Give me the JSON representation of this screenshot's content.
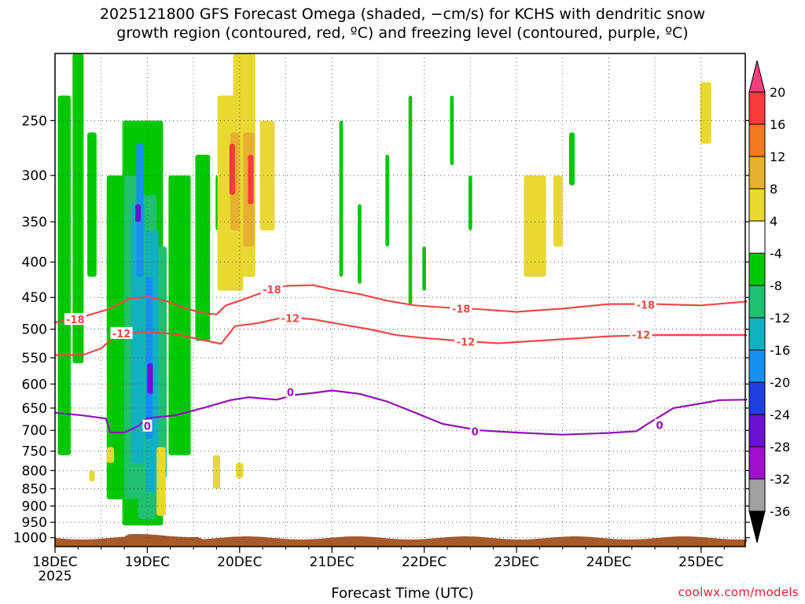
{
  "title": {
    "line1": "2025121800 GFS Forecast Omega (shaded, −cm/s) for KCHS with dendritic snow",
    "line2": "growth region (contoured, red, ºC) and freezing level (contoured, purple, ºC)"
  },
  "xlabel": "Forecast Time (UTC)",
  "credit": "coolwx.com/models",
  "chart_data": {
    "type": "heatmap",
    "title": "2025121800 GFS Forecast Omega (shaded, −cm/s) for KCHS with dendritic snow growth region (contoured, red, ºC) and freezing level (contoured, purple, ºC)",
    "xlabel": "Forecast Time (UTC)",
    "ylabel": "",
    "y_scale": "log-pressure (inverted)",
    "grid": true,
    "x_ticks": [
      {
        "label": "18DEC",
        "sub": "2025",
        "day": 0
      },
      {
        "label": "19DEC",
        "day": 1
      },
      {
        "label": "20DEC",
        "day": 2
      },
      {
        "label": "21DEC",
        "day": 3
      },
      {
        "label": "22DEC",
        "day": 4
      },
      {
        "label": "23DEC",
        "day": 5
      },
      {
        "label": "24DEC",
        "day": 6
      },
      {
        "label": "25DEC",
        "day": 7
      }
    ],
    "xlim_days": [
      0,
      7.5
    ],
    "y_ticks": [
      250,
      300,
      350,
      400,
      450,
      500,
      550,
      600,
      650,
      700,
      750,
      800,
      850,
      900,
      950,
      1000
    ],
    "ylim_hpa": [
      200,
      1030
    ],
    "colorbar": {
      "labels": [
        "20",
        "16",
        "12",
        "8",
        "4",
        "-4",
        "-8",
        "-12",
        "-16",
        "-20",
        "-24",
        "-28",
        "-32",
        "-36"
      ],
      "colors": [
        "#f0407a",
        "#f43c3c",
        "#f07a20",
        "#e8b030",
        "#e8d830",
        "#ffffff",
        "#00c800",
        "#20c070",
        "#10b0c0",
        "#1890f0",
        "#2040e0",
        "#6a10d0",
        "#a010c8",
        "#a0a0a0",
        "#000000"
      ]
    },
    "series": [
      {
        "name": "-18",
        "color": "#f04848",
        "points": [
          [
            0,
            489
          ],
          [
            0.3,
            480
          ],
          [
            0.6,
            467
          ],
          [
            0.8,
            452
          ],
          [
            1.0,
            449
          ],
          [
            1.2,
            455
          ],
          [
            1.4,
            466
          ],
          [
            1.6,
            474
          ],
          [
            1.75,
            476
          ],
          [
            1.85,
            462
          ],
          [
            2.0,
            455
          ],
          [
            2.2,
            445
          ],
          [
            2.5,
            433
          ],
          [
            2.8,
            432
          ],
          [
            3.0,
            438
          ],
          [
            3.3,
            445
          ],
          [
            3.6,
            455
          ],
          [
            3.9,
            462
          ],
          [
            4.2,
            465
          ],
          [
            4.6,
            468
          ],
          [
            5.0,
            472
          ],
          [
            5.5,
            467
          ],
          [
            6.0,
            460
          ],
          [
            6.5,
            460
          ],
          [
            7.0,
            462
          ],
          [
            7.5,
            456
          ]
        ]
      },
      {
        "name": "-12",
        "color": "#f04848",
        "points": [
          [
            0,
            545
          ],
          [
            0.3,
            545
          ],
          [
            0.5,
            533
          ],
          [
            0.7,
            505
          ],
          [
            1.0,
            505
          ],
          [
            1.3,
            508
          ],
          [
            1.5,
            515
          ],
          [
            1.65,
            520
          ],
          [
            1.8,
            525
          ],
          [
            1.95,
            495
          ],
          [
            2.2,
            490
          ],
          [
            2.5,
            480
          ],
          [
            2.8,
            484
          ],
          [
            3.1,
            492
          ],
          [
            3.4,
            500
          ],
          [
            3.7,
            510
          ],
          [
            4.0,
            515
          ],
          [
            4.4,
            520
          ],
          [
            4.8,
            524
          ],
          [
            5.2,
            520
          ],
          [
            5.6,
            516
          ],
          [
            6.0,
            512
          ],
          [
            6.5,
            510
          ],
          [
            7.0,
            510
          ],
          [
            7.5,
            510
          ]
        ]
      },
      {
        "name": "0",
        "color": "#9010b8",
        "points": [
          [
            0,
            660
          ],
          [
            0.3,
            666
          ],
          [
            0.55,
            673
          ],
          [
            0.6,
            705
          ],
          [
            0.75,
            705
          ],
          [
            0.9,
            690
          ],
          [
            1.0,
            672
          ],
          [
            1.3,
            666
          ],
          [
            1.6,
            650
          ],
          [
            1.9,
            633
          ],
          [
            2.1,
            627
          ],
          [
            2.4,
            632
          ],
          [
            2.6,
            622
          ],
          [
            2.8,
            618
          ],
          [
            3.0,
            613
          ],
          [
            3.3,
            620
          ],
          [
            3.6,
            636
          ],
          [
            3.9,
            660
          ],
          [
            4.2,
            685
          ],
          [
            4.6,
            700
          ],
          [
            5.0,
            705
          ],
          [
            5.5,
            710
          ],
          [
            6.0,
            706
          ],
          [
            6.3,
            702
          ],
          [
            6.4,
            688
          ],
          [
            6.7,
            650
          ],
          [
            7.0,
            640
          ],
          [
            7.2,
            633
          ],
          [
            7.5,
            632
          ]
        ]
      }
    ],
    "contour_labels": [
      {
        "text": "-18",
        "day": 0.22,
        "p": 484
      },
      {
        "text": "-18",
        "day": 2.35,
        "p": 438
      },
      {
        "text": "-18",
        "day": 4.4,
        "p": 467
      },
      {
        "text": "-18",
        "day": 6.4,
        "p": 461
      },
      {
        "text": "-12",
        "day": 0.72,
        "p": 507
      },
      {
        "text": "-12",
        "day": 2.55,
        "p": 482
      },
      {
        "text": "-12",
        "day": 4.45,
        "p": 521
      },
      {
        "text": "-12",
        "day": 6.35,
        "p": 509
      },
      {
        "text": "0",
        "day": 1.0,
        "p": 690
      },
      {
        "text": "0",
        "day": 2.55,
        "p": 616
      },
      {
        "text": "0",
        "day": 4.55,
        "p": 702
      },
      {
        "text": "0",
        "day": 6.55,
        "p": 688
      }
    ]
  }
}
